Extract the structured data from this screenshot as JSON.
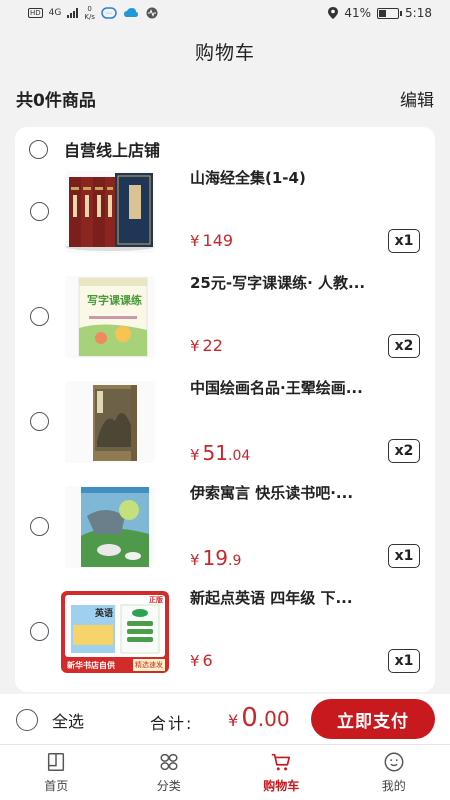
{
  "status_bar": {
    "network_badge": "HD",
    "network_type": "4G",
    "speed_value": "0",
    "speed_unit": "K/s",
    "battery_percent": "41%",
    "battery_level": 0.41,
    "time": "5:18"
  },
  "header": {
    "title": "购物车"
  },
  "summary": {
    "count_text": "共0件商品",
    "edit_label": "编辑"
  },
  "store": {
    "name": "自营线上店铺"
  },
  "items": [
    {
      "title": "山海经全集(1-4)",
      "currency": "¥",
      "price_int": "149",
      "price_dec": "",
      "qty": "x1"
    },
    {
      "title": "25元-写字课课练· 人教...",
      "currency": "¥",
      "price_int": "22",
      "price_dec": "",
      "qty": "x2"
    },
    {
      "title": "中国绘画名品·王翚绘画...",
      "currency": "¥",
      "price_int": "51",
      "price_dec": ".04",
      "qty": "x2"
    },
    {
      "title": "伊索寓言 快乐读书吧·...",
      "currency": "¥",
      "price_int": "19",
      "price_dec": ".9",
      "qty": "x1"
    },
    {
      "title": "新起点英语 四年级 下...",
      "currency": "¥",
      "price_int": "6",
      "price_dec": "",
      "qty": "x1"
    }
  ],
  "thumb_text": {
    "book2_title": "写字课课练",
    "book5_tag": "正版",
    "book5_subject": "英语",
    "book5_banner": "新华书店自供",
    "book5_badge": "精选速发"
  },
  "footer": {
    "select_all_label": "全选",
    "total_label": "合计:",
    "total_currency": "¥",
    "total_int": "0",
    "total_dec": ".00",
    "pay_label": "立即支付"
  },
  "tabs": [
    {
      "label": "首页",
      "icon": "home-icon",
      "active": false
    },
    {
      "label": "分类",
      "icon": "category-icon",
      "active": false
    },
    {
      "label": "购物车",
      "icon": "cart-icon",
      "active": true
    },
    {
      "label": "我的",
      "icon": "profile-icon",
      "active": false
    }
  ],
  "colors": {
    "accent": "#c8191e",
    "price": "#c8272d",
    "background": "#f2f2f2"
  }
}
